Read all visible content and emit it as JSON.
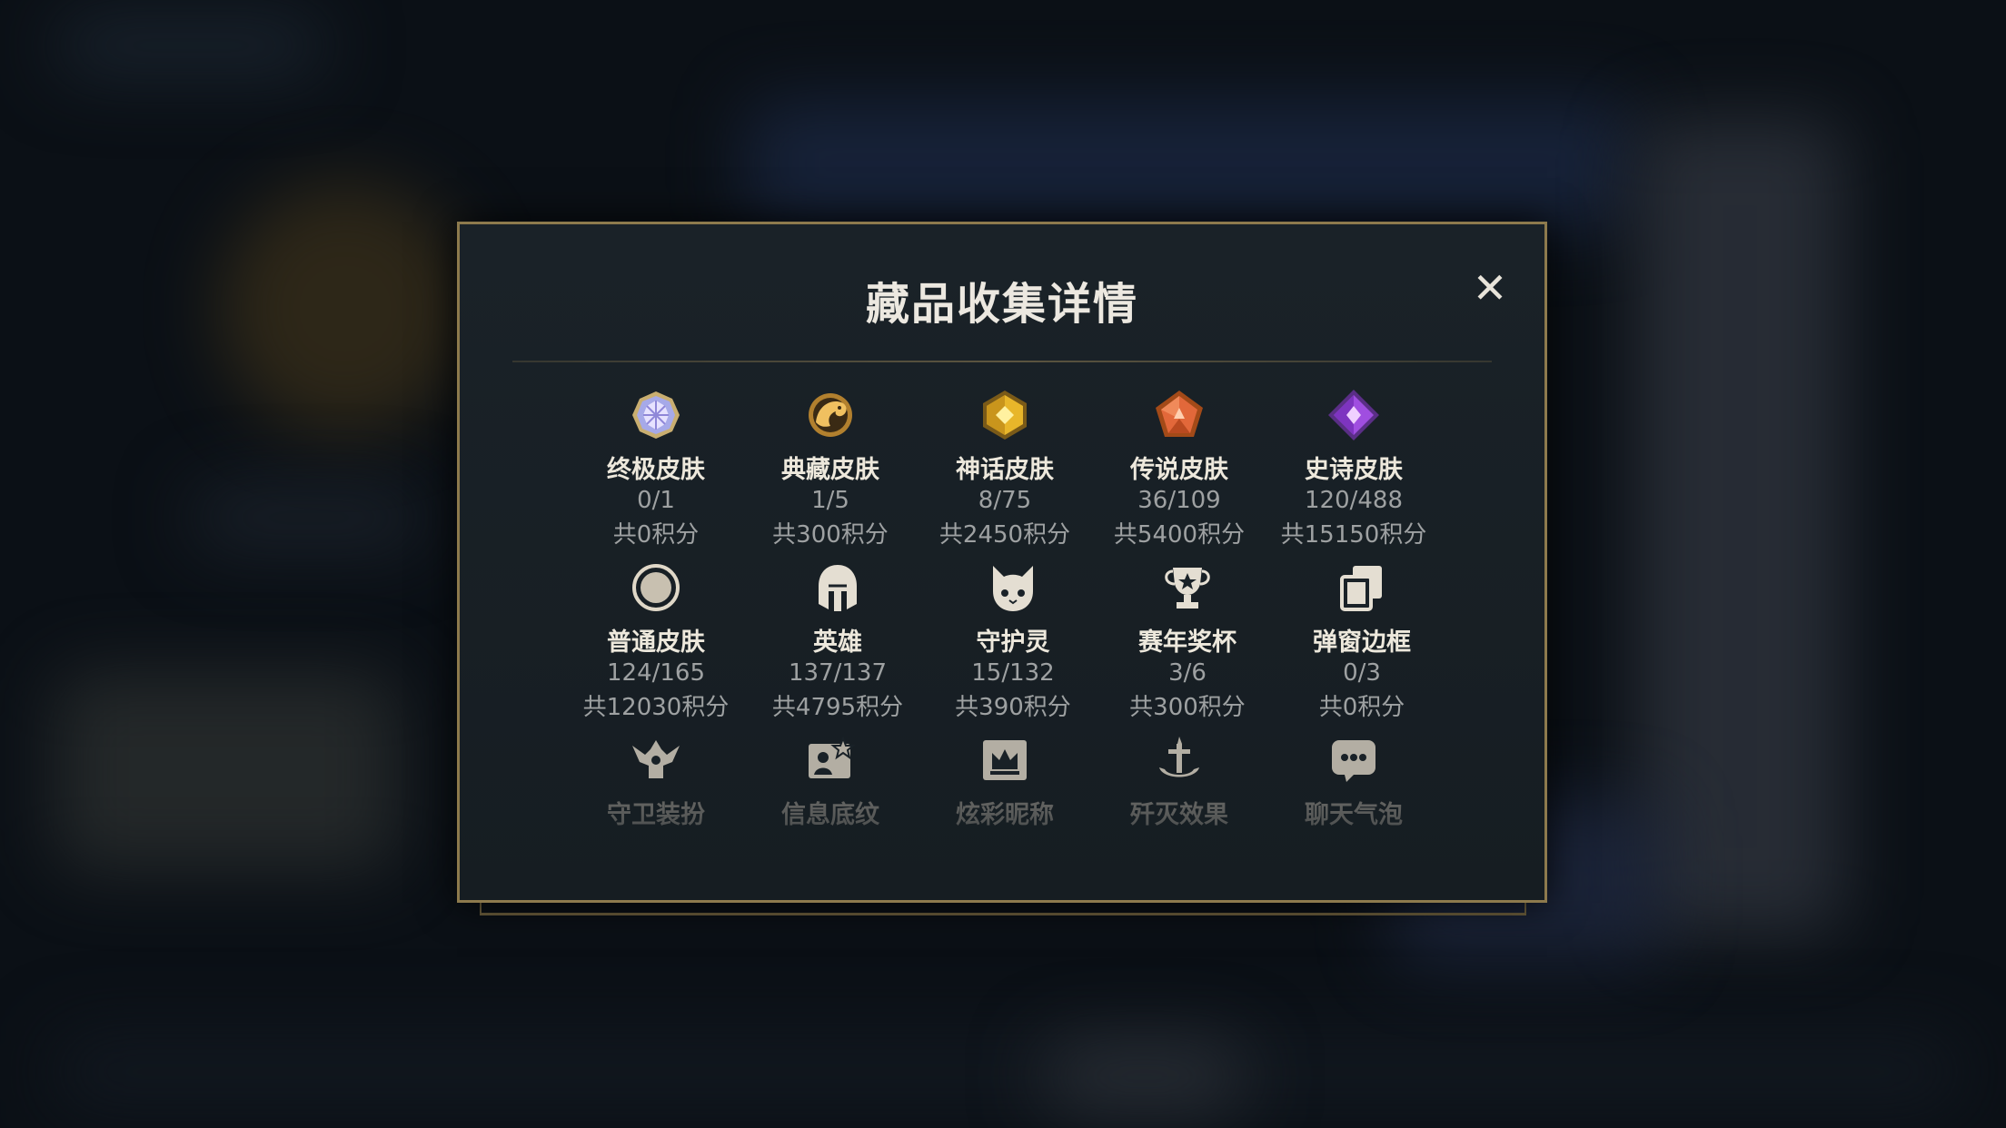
{
  "dialog": {
    "title": "藏品收集详情",
    "close_label": "✕",
    "row1": [
      {
        "icon": "ultimate-skin-gem-icon",
        "label": "终极皮肤",
        "count": "0/1",
        "points": "共0积分"
      },
      {
        "icon": "collector-skin-dragon-icon",
        "label": "典藏皮肤",
        "count": "1/5",
        "points": "共300积分"
      },
      {
        "icon": "mythic-skin-gem-icon",
        "label": "神话皮肤",
        "count": "8/75",
        "points": "共2450积分"
      },
      {
        "icon": "legendary-skin-gem-icon",
        "label": "传说皮肤",
        "count": "36/109",
        "points": "共5400积分"
      },
      {
        "icon": "epic-skin-gem-icon",
        "label": "史诗皮肤",
        "count": "120/488",
        "points": "共15150积分"
      }
    ],
    "row2": [
      {
        "icon": "normal-skin-ring-icon",
        "label": "普通皮肤",
        "count": "124/165",
        "points": "共12030积分"
      },
      {
        "icon": "hero-helmet-icon",
        "label": "英雄",
        "count": "137/137",
        "points": "共4795积分"
      },
      {
        "icon": "guardian-spirit-icon",
        "label": "守护灵",
        "count": "15/132",
        "points": "共390积分"
      },
      {
        "icon": "season-trophy-icon",
        "label": "赛年奖杯",
        "count": "3/6",
        "points": "共300积分"
      },
      {
        "icon": "popup-frame-icon",
        "label": "弹窗边框",
        "count": "0/3",
        "points": "共0积分"
      }
    ],
    "row3": [
      {
        "icon": "guardian-outfit-icon",
        "label": "守卫装扮"
      },
      {
        "icon": "info-pattern-icon",
        "label": "信息底纹"
      },
      {
        "icon": "colorful-nickname-icon",
        "label": "炫彩昵称"
      },
      {
        "icon": "elimination-effect-icon",
        "label": "歼灭效果"
      },
      {
        "icon": "chat-bubble-icon",
        "label": "聊天气泡"
      }
    ]
  }
}
